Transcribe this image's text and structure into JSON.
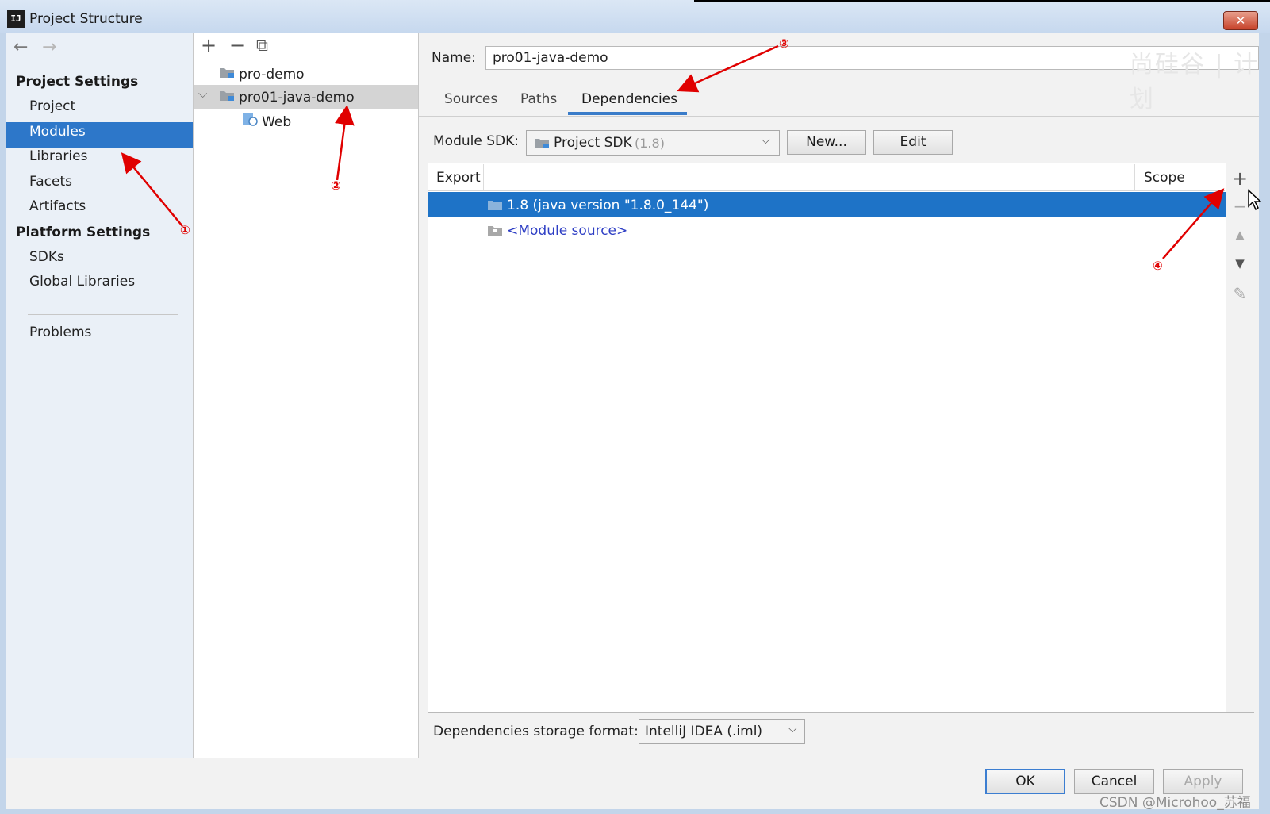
{
  "window": {
    "title": "Project Structure",
    "app_badge": "IJ",
    "close_glyph": "✕"
  },
  "watermark_text": "尚硅谷 | 计划",
  "left_nav": {
    "back_icon": "←",
    "forward_icon": "→",
    "project_settings_heading": "Project Settings",
    "project_items": [
      "Project",
      "Modules",
      "Libraries",
      "Facets",
      "Artifacts"
    ],
    "selected_item": "Modules",
    "platform_settings_heading": "Platform Settings",
    "platform_items": [
      "SDKs",
      "Global Libraries"
    ],
    "problems": "Problems"
  },
  "module_tree": {
    "add_icon": "+",
    "remove_icon": "−",
    "copy_icon": "⧉",
    "expander": "⌵",
    "items": [
      {
        "label": "pro-demo"
      },
      {
        "label": "pro01-java-demo",
        "selected": true
      },
      {
        "label": "Web"
      }
    ]
  },
  "detail": {
    "name_label": "Name:",
    "name_value": "pro01-java-demo",
    "tabs": [
      "Sources",
      "Paths",
      "Dependencies"
    ],
    "active_tab": "Dependencies",
    "module_sdk_label": "Module SDK:",
    "module_sdk_value": "Project SDK",
    "module_sdk_version": "(1.8)",
    "new_button": "New...",
    "edit_button": "Edit",
    "table": {
      "col_export": "Export",
      "col_scope": "Scope",
      "rows": [
        {
          "label": "1.8 (java version \"1.8.0_144\")",
          "selected": true
        },
        {
          "label": "<Module source>",
          "selected": false
        }
      ]
    },
    "side_tools": [
      "+",
      "−",
      "▲",
      "▼",
      "✎"
    ],
    "storage_label": "Dependencies storage format:",
    "storage_value": "IntelliJ IDEA (.iml)"
  },
  "footer": {
    "ok": "OK",
    "cancel": "Cancel",
    "apply": "Apply"
  },
  "annotations": [
    "①",
    "②",
    "③",
    "④"
  ],
  "credit": "CSDN @Microhoo_苏福",
  "colors": {
    "selection": "#2d77c9",
    "annotation": "#e00000",
    "tab_underline": "#3a7cc9"
  }
}
